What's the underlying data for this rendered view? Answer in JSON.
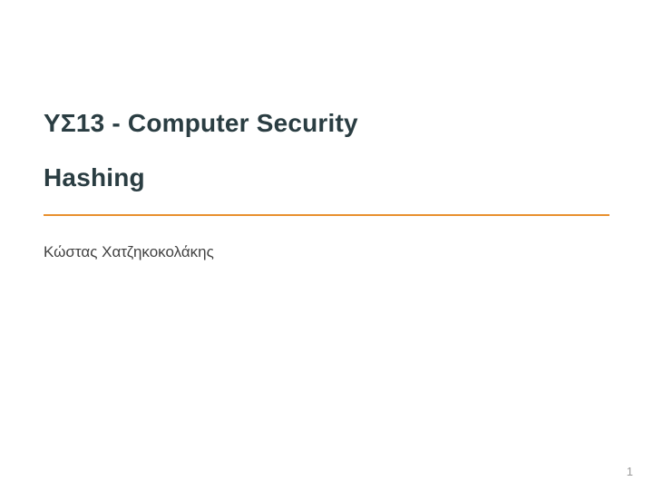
{
  "slide": {
    "course_title": "ΥΣ13 - Computer Security",
    "topic_title": "Hashing",
    "author": "Κώστας Χατζηκοκολάκης",
    "page_number": "1",
    "accent_color": "#e8902e",
    "heading_color": "#2a3d42"
  }
}
